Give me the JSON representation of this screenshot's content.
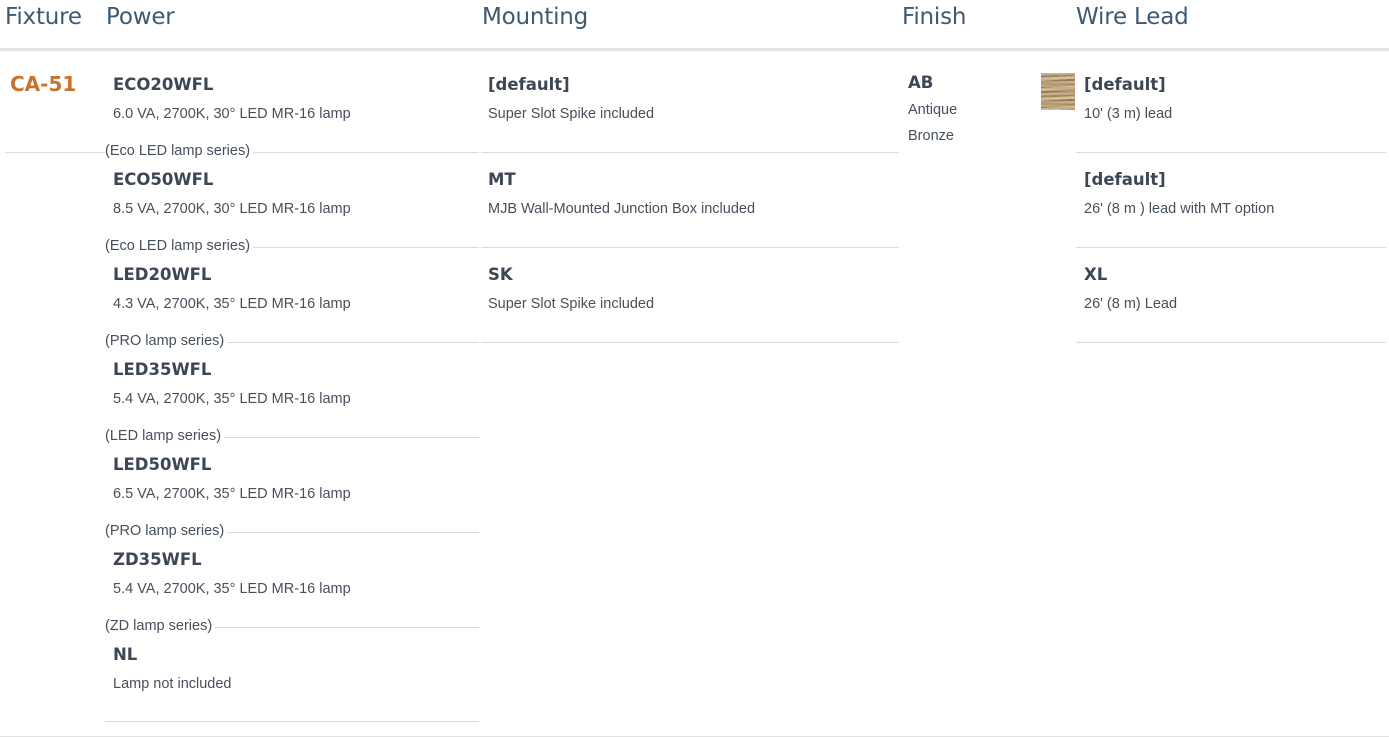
{
  "headers": {
    "fixture": "Fixture",
    "power": "Power",
    "mounting": "Mounting",
    "finish": "Finish",
    "wire_lead": "Wire Lead"
  },
  "fixture": {
    "code": "CA-51"
  },
  "power": [
    {
      "code": "ECO20WFL",
      "desc": "6.0 VA, 2700K, 30° LED MR-16 lamp",
      "series": "(Eco LED lamp series)"
    },
    {
      "code": "ECO50WFL",
      "desc": "8.5 VA, 2700K, 30° LED MR-16 lamp",
      "series": "(Eco LED lamp series)"
    },
    {
      "code": "LED20WFL",
      "desc": "4.3 VA, 2700K, 35° LED MR-16 lamp",
      "series": "(PRO lamp series)"
    },
    {
      "code": "LED35WFL",
      "desc": "5.4 VA, 2700K, 35° LED MR-16 lamp",
      "series": "(LED lamp series)"
    },
    {
      "code": "LED50WFL",
      "desc": "6.5 VA, 2700K, 35° LED MR-16 lamp",
      "series": "(PRO lamp series)"
    },
    {
      "code": "ZD35WFL",
      "desc": "5.4 VA, 2700K, 35° LED MR-16 lamp",
      "series": "(ZD lamp series)"
    },
    {
      "code": "NL",
      "desc": "Lamp not included"
    }
  ],
  "mounting": [
    {
      "code": "[default]",
      "desc": "Super Slot Spike included"
    },
    {
      "code": "MT",
      "desc": "MJB Wall-Mounted Junction Box included"
    },
    {
      "code": "SK",
      "desc": "Super Slot Spike included"
    }
  ],
  "finish": [
    {
      "code": "AB",
      "desc_line1": "Antique",
      "desc_line2": "Bronze",
      "swatch_icon": "wood-grain-swatch",
      "swatch_color": "#b39668"
    }
  ],
  "wire_lead": [
    {
      "code": "[default]",
      "desc": "10' (3 m) lead"
    },
    {
      "code": "[default]",
      "desc": "26' (8 m ) lead with MT option"
    },
    {
      "code": "XL",
      "desc": "26' (8 m) Lead"
    }
  ]
}
